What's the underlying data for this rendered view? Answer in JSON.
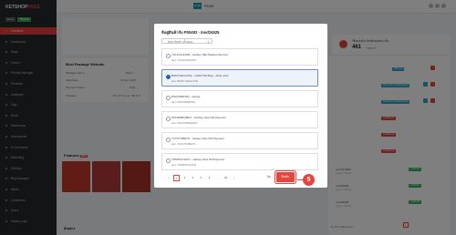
{
  "sidebar": {
    "logo": "KETSHOP",
    "logo_accent": "PAGE",
    "badge_left": "Basic",
    "badge_right": "เชื่อมต่อ",
    "items": [
      {
        "label": "Overview",
        "active": true
      },
      {
        "label": "Dashboard",
        "active": false
      },
      {
        "label": "Sales",
        "active": false
      },
      {
        "label": "Orders",
        "active": false
      },
      {
        "label": "Product Manager",
        "active": false
      },
      {
        "label": "Products",
        "active": false
      },
      {
        "label": "Collection",
        "active": false
      },
      {
        "label": "Tags",
        "active": false
      },
      {
        "label": "Stock",
        "active": false
      },
      {
        "label": "Warehouse",
        "active": false
      },
      {
        "label": "Accessories",
        "active": false
      },
      {
        "label": "E-Commerce",
        "active": false
      },
      {
        "label": "Marketing",
        "active": false
      },
      {
        "label": "Settings",
        "active": false
      },
      {
        "label": "Blog Manager",
        "active": false
      },
      {
        "label": "Media",
        "active": false
      },
      {
        "label": "Customers",
        "active": false
      },
      {
        "label": "Users",
        "active": false
      },
      {
        "label": "History Logs",
        "active": false
      }
    ]
  },
  "topbar": {
    "shop_icon_label": "Peak",
    "shop_name": "PEAK"
  },
  "package_card": {
    "title": "Best Package Website",
    "rows": [
      {
        "label": "Package Name",
        "value": "Basic"
      },
      {
        "label": "Valid Date",
        "value": "31 Dec 2025"
      },
      {
        "label": "Payment Status",
        "value": "Paid"
      },
      {
        "label": "Package",
        "value": "Pro 875 or per 3M 6 Yr"
      }
    ]
  },
  "feature_section": {
    "title": "Features",
    "badge": "NEW"
  },
  "footer_label": "ตัวอย่าง",
  "stats_card": {
    "label": "เชื่อมต่อกับ Ketshopweb แล้ว",
    "value": "461",
    "unit": "รายการ"
  },
  "modal": {
    "title": "จับคู่สินค้ากับ P00492 - mod24525",
    "filter_placeholder": "ค้นหาสินค้า (ทั้งหมด)",
    "items": [
      {
        "name": "YOULOOKHIM - Harbey Talk Platform/Summit",
        "sku": "sku: YOULOOKHIM",
        "selected": false
      },
      {
        "name": "BODYVEGCATE - CARLYNN Bag - white color",
        "sku": "sku: BODYVEGCATE",
        "selected": true
      },
      {
        "name": "DSGNFBF45U - saving",
        "sku": "sku: DSGNFBF45U",
        "selected": false
      },
      {
        "name": "PAC5K8RQMKC - Harbey New Old Payment",
        "sku": "sku: PAC5K8RQMKC",
        "selected": false
      },
      {
        "name": "TUVUTUBETO - Harbey New Old Payment",
        "sku": "sku: TUVUTUBETO",
        "selected": false
      },
      {
        "name": "TOMPHYHATO - Harbey New Old Payment",
        "sku": "sku: TOMPHYHATO",
        "selected": false
      }
    ],
    "pagination": [
      "‹",
      "1",
      "2",
      "3",
      "4",
      "5",
      "…",
      "30",
      "›"
    ],
    "active_page": "1",
    "cancel_label": "ปิด",
    "confirm_label": "ยืนยัน"
  },
  "annotation": {
    "step_number": "5"
  },
  "table": {
    "rows": [
      {
        "sku": "sam36-9988",
        "sub": "Lorem - Shoes",
        "price": "1,490.00"
      },
      {
        "sku": "mod24598",
        "sub": "Lorem - Shoes",
        "price": "2,000.00"
      },
      {
        "sku": "mod24599",
        "sub": "Lorem - Shoes",
        "price": "1,200.00"
      }
    ],
    "footer": "41-60 of 900 items",
    "pills": [
      "เชื่อมต่อ",
      "เชื่อมต่อกับ Ketshopweb",
      "ไม่เชื่อมต่อ"
    ]
  },
  "colors": {
    "accent": "#e8433c",
    "sidebar_bg": "#26282d",
    "select_blue": "#2f62b3",
    "teal": "#1a9ab0"
  }
}
